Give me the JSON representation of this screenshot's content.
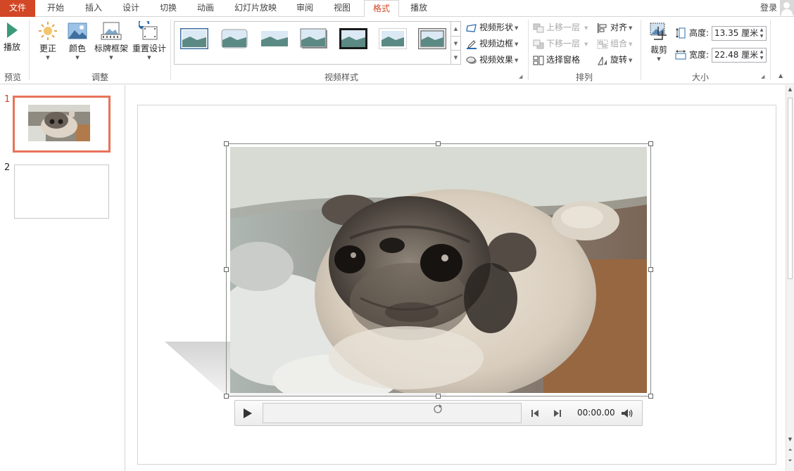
{
  "tabs": [
    {
      "label": "文件",
      "active": false
    },
    {
      "label": "开始",
      "active": false
    },
    {
      "label": "插入",
      "active": false
    },
    {
      "label": "设计",
      "active": false
    },
    {
      "label": "切换",
      "active": false
    },
    {
      "label": "动画",
      "active": false
    },
    {
      "label": "幻灯片放映",
      "active": false
    },
    {
      "label": "审阅",
      "active": false
    },
    {
      "label": "视图",
      "active": false
    },
    {
      "label": "格式",
      "active": true
    },
    {
      "label": "播放",
      "active": false
    }
  ],
  "login": "登录",
  "ribbon": {
    "preview": {
      "play": "播放",
      "group": "预览"
    },
    "adjust": {
      "correct": "更正",
      "color": "颜色",
      "poster_frame": "标牌框架",
      "reset_design": "重置设计",
      "group": "调整"
    },
    "video_styles": {
      "shape": "视频形状",
      "border": "视频边框",
      "effects": "视频效果",
      "group": "视频样式"
    },
    "arrange": {
      "bring_forward": "上移一层",
      "send_backward": "下移一层",
      "selection_pane": "选择窗格",
      "align": "对齐",
      "group_btn": "组合",
      "rotate": "旋转",
      "group": "排列"
    },
    "size": {
      "crop": "裁剪",
      "height_label": "高度:",
      "height_value": "13.35 厘米",
      "width_label": "宽度:",
      "width_value": "22.48 厘米",
      "group": "大小"
    }
  },
  "slides": [
    {
      "number": "1",
      "selected": true
    },
    {
      "number": "2",
      "selected": false
    }
  ],
  "player": {
    "time": "00:00.00"
  },
  "colors": {
    "accent": "#d24726",
    "selected_slide_border": "#e8735a"
  }
}
